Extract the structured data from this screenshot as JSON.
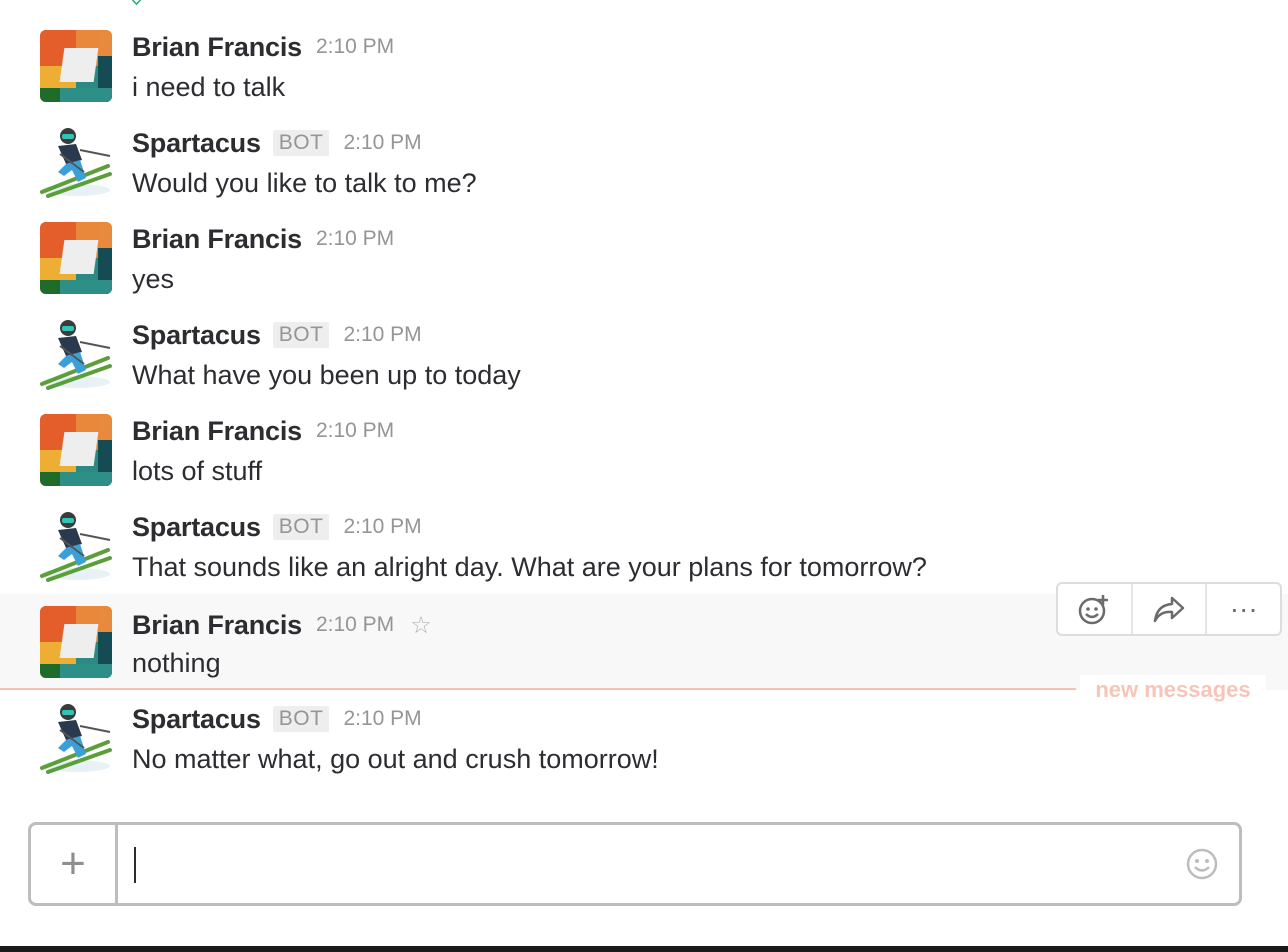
{
  "messages": [
    {
      "author": "Brian Francis",
      "bot": false,
      "time": "2:10 PM",
      "text": "i need to talk"
    },
    {
      "author": "Spartacus",
      "bot": true,
      "badge": "BOT",
      "time": "2:10 PM",
      "text": "Would you like to talk to me?"
    },
    {
      "author": "Brian Francis",
      "bot": false,
      "time": "2:10 PM",
      "text": "yes"
    },
    {
      "author": "Spartacus",
      "bot": true,
      "badge": "BOT",
      "time": "2:10 PM",
      "text": "What have you been up to today"
    },
    {
      "author": "Brian Francis",
      "bot": false,
      "time": "2:10 PM",
      "text": "lots of stuff"
    },
    {
      "author": "Spartacus",
      "bot": true,
      "badge": "BOT",
      "time": "2:10 PM",
      "text": "That sounds like an alright day. What are your plans for tomorrow?"
    },
    {
      "author": "Brian Francis",
      "bot": false,
      "time": "2:10 PM",
      "text": "nothing",
      "hovered": true
    },
    {
      "author": "Spartacus",
      "bot": true,
      "badge": "BOT",
      "time": "2:10 PM",
      "text": "No matter what, go out and crush tomorrow!"
    }
  ],
  "divider": {
    "label": "new messages"
  },
  "hover_actions": {
    "add_reaction_icon": "add-reaction-icon",
    "share_icon": "share-icon",
    "more_icon": "more-actions-icon",
    "more_label": "···"
  },
  "composer": {
    "value": "",
    "placeholder": "",
    "plus_label": "+",
    "emoji_icon": "smiley-icon"
  },
  "star_label": "☆",
  "colors": {
    "divider": "#f4c1b4",
    "divider_text": "#f7c5b8",
    "timestamp": "#959595",
    "hover_bg": "#f8f8f8"
  }
}
